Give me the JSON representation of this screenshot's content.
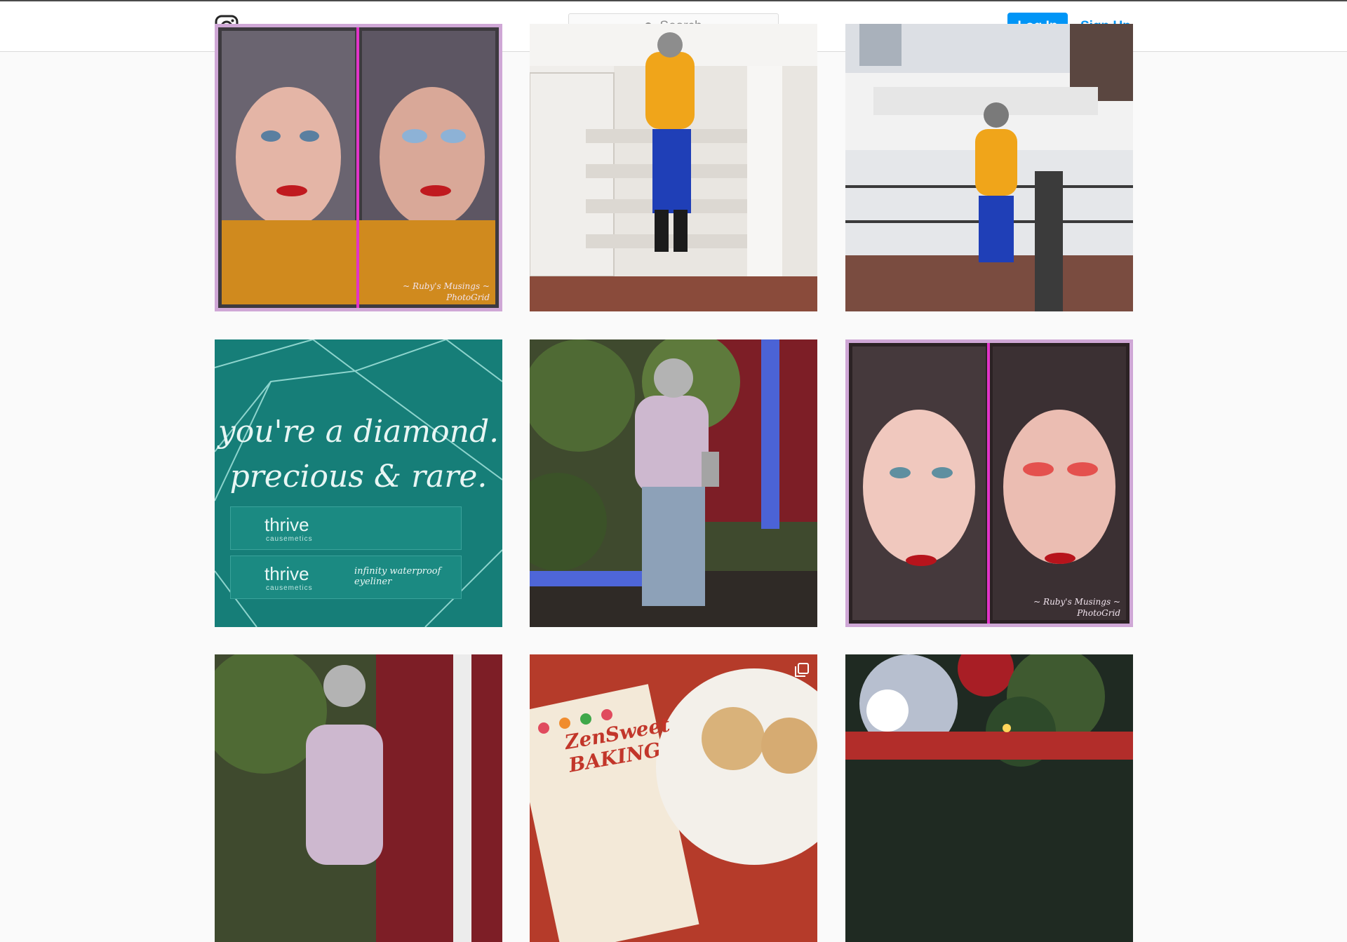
{
  "header": {
    "search": {
      "placeholder": "Search"
    },
    "login_label": "Log In",
    "signup_label": "Sign Up"
  },
  "posts": [
    {
      "watermark_line1": "~ Ruby's Musings ~",
      "watermark_line2": "PhotoGrid"
    },
    {},
    {},
    {
      "quote_line1": "you're a diamond.",
      "quote_line2": "precious & rare.",
      "product1_brand": "thrive",
      "product1_sub": "causemetics",
      "product2_brand": "thrive",
      "product2_sub": "causemetics",
      "product2_note": "infinity waterproof eyeliner"
    },
    {},
    {
      "watermark_line1": "~ Ruby's Musings ~",
      "watermark_line2": "PhotoGrid"
    },
    {},
    {
      "book_title": "ZenSweet",
      "book_title2": "BAKING"
    },
    {}
  ],
  "colors": {
    "accent": "#0095f6",
    "border": "#dbdbdb",
    "background": "#fafafa"
  }
}
